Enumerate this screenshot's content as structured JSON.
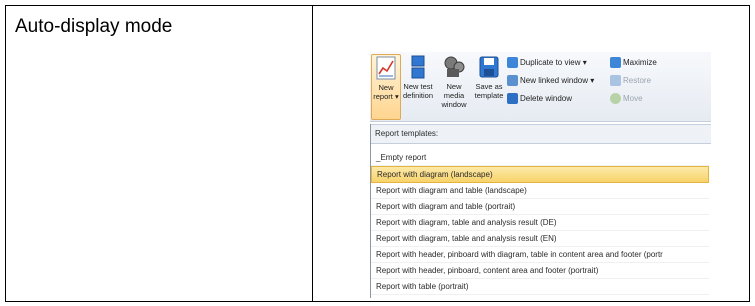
{
  "table": {
    "left_cell_label": "Auto-display mode"
  },
  "ribbon": {
    "new_report_label": "New\nreport ▾",
    "new_test_definition_label": "New test\ndefinition",
    "new_media_window_label": "New media\nwindow",
    "save_as_template_label": "Save as\ntemplate",
    "duplicate_to_view_label": "Duplicate to view ▾",
    "new_linked_window_label": "New linked window ▾",
    "delete_window_label": "Delete window",
    "maximize_label": "Maximize",
    "restore_label": "Restore",
    "move_label": "Move"
  },
  "dropdown": {
    "header": "Report templates:",
    "items": [
      "_Empty report",
      "Report with diagram (landscape)",
      "Report with diagram and table (landscape)",
      "Report with diagram and table (portrait)",
      "Report with diagram, table and analysis result (DE)",
      "Report with diagram, table and analysis result (EN)",
      "Report with header, pinboard with diagram, table in content area and footer (portr",
      "Report with header, pinboard, content area and footer (portrait)",
      "Report with table (portrait)"
    ],
    "selected_index": 1
  },
  "colors": {
    "accent_highlight": "#f7d36b",
    "ribbon_background": "#e6ebf2",
    "border": "#000000"
  }
}
